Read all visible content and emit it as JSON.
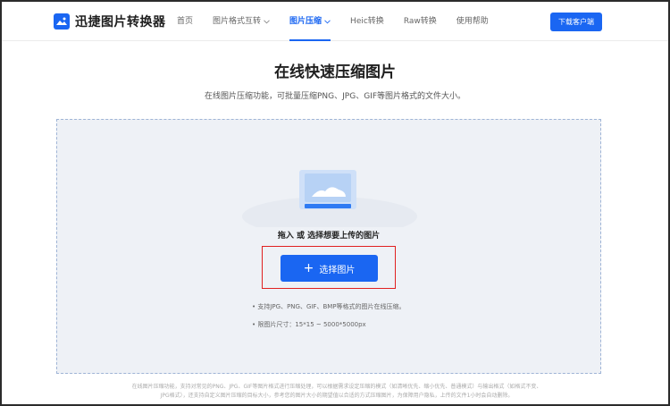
{
  "header": {
    "logo_text": "迅捷图片转换器",
    "nav": [
      {
        "label": "首页",
        "active": false
      },
      {
        "label": "图片格式互转",
        "active": false,
        "dropdown": true
      },
      {
        "label": "图片压缩",
        "active": true,
        "dropdown": true
      },
      {
        "label": "Heic转换",
        "active": false
      },
      {
        "label": "Raw转换",
        "active": false
      },
      {
        "label": "使用帮助",
        "active": false
      }
    ],
    "download_label": "下载客户端"
  },
  "main": {
    "title": "在线快速压缩图片",
    "subtitle": "在线图片压缩功能，可批量压缩PNG、JPG、GIF等图片格式的文件大小。"
  },
  "upload": {
    "label": "拖入 或 选择想要上传的图片",
    "button_label": "选择图片",
    "hints": [
      "• 支持JPG、PNG、GIF、BMP等格式的图片在线压缩。",
      "• 限图片尺寸：15*15 ~ 5000*5000px"
    ]
  },
  "footer": {
    "line1": "在线图片压缩功能，支持对常见的PNG、JPG、GIF等图片格式进行压缩处理，可以根据需求设定压缩的模式（如清晰优先、缩小优先、普通模式）与输出格式（如格式不变、",
    "line2": "JPG格式），还支持自定义图片压缩的目标大小，参考您的图片大小的期望值以合适的方式压缩图片，为保障用户隐私，上传的文件1小时会自动删除。"
  },
  "colors": {
    "accent": "#1a66f2",
    "highlight_box": "#e02020",
    "upload_bg": "#eef1f6"
  }
}
